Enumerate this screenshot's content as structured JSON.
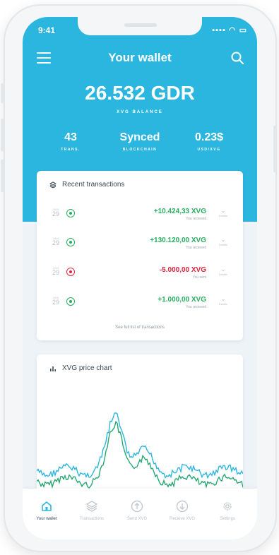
{
  "status_bar": {
    "time": "9:41"
  },
  "header": {
    "title": "Your wallet"
  },
  "balance": {
    "amount": "26.532 GDR",
    "label": "XVG BALANCE"
  },
  "stats": [
    {
      "value": "43",
      "label": "TRANS."
    },
    {
      "value": "Synced",
      "label": "BLOCKCHAIN"
    },
    {
      "value": "0.23$",
      "label": "USD/XVG"
    }
  ],
  "transactions": {
    "title": "Recent transactions",
    "items": [
      {
        "month": "JAN",
        "day": "29",
        "amount": "+10.424,33 XVG",
        "note": "You recieved",
        "details": "Details",
        "type": "received",
        "color": "#27ae60"
      },
      {
        "month": "JAN",
        "day": "29",
        "amount": "+130.120,00 XVG",
        "note": "You recieved",
        "details": "Details",
        "type": "received",
        "color": "#27ae60"
      },
      {
        "month": "JAN",
        "day": "29",
        "amount": "-5.000,00 XVG",
        "note": "You sent",
        "details": "Details",
        "type": "sent",
        "color": "#e0243c"
      },
      {
        "month": "JAN",
        "day": "29",
        "amount": "+1.000,00 XVG",
        "note": "You recieved",
        "details": "Details",
        "type": "received",
        "color": "#27ae60"
      }
    ],
    "see_all": "See full list of transactions"
  },
  "price_chart": {
    "title": "XVG price chart",
    "colors": {
      "blue": "#2bb6df",
      "green": "#27a872"
    }
  },
  "tabbar": {
    "items": [
      {
        "label": "Your wallet",
        "icon": "home-icon",
        "active": true
      },
      {
        "label": "Transactions",
        "icon": "layers-icon",
        "active": false
      },
      {
        "label": "Send XVG",
        "icon": "arrow-up-circle-icon",
        "active": false
      },
      {
        "label": "Recieve XVG",
        "icon": "arrow-down-circle-icon",
        "active": false
      },
      {
        "label": "Settings",
        "icon": "gear-icon",
        "active": false
      }
    ]
  },
  "colors": {
    "accent": "#2bb6df",
    "received": "#27ae60",
    "sent": "#e0243c"
  }
}
